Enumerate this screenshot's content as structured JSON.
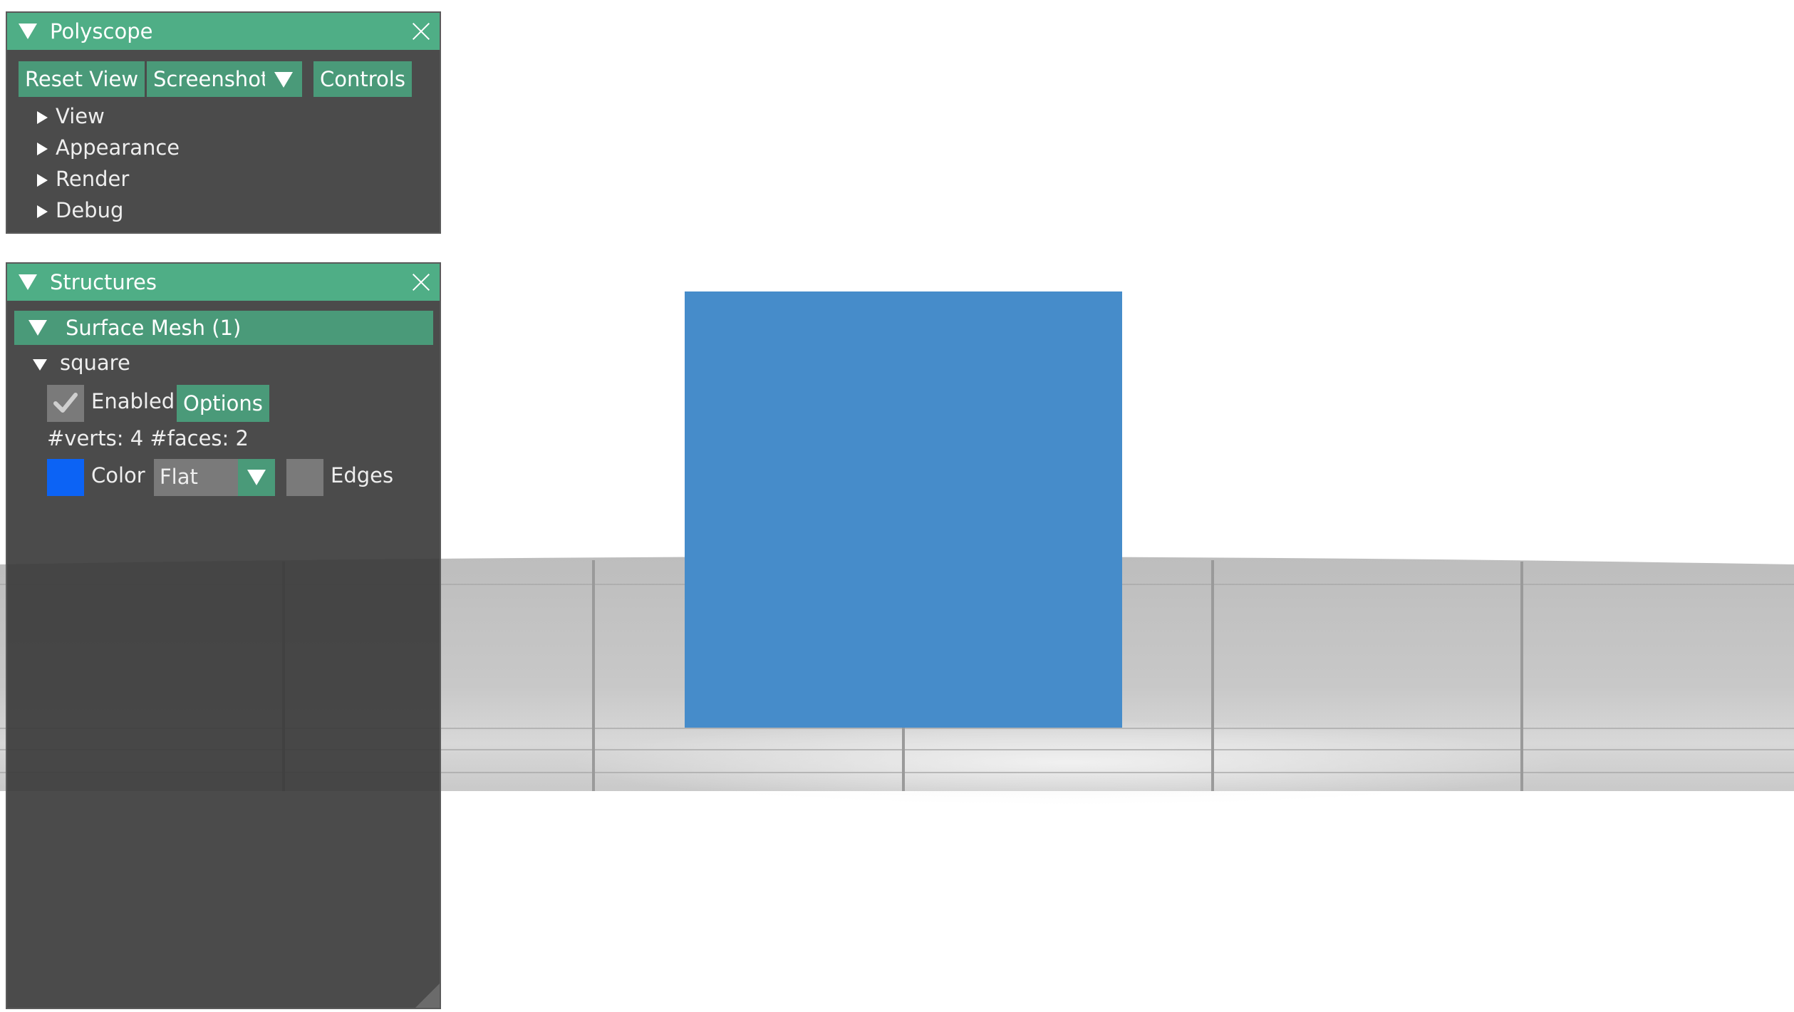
{
  "polyscope_window": {
    "title": "Polyscope",
    "buttons": {
      "reset_view": "Reset View",
      "screenshot": "Screenshot",
      "controls": "Controls"
    },
    "tree_items": [
      "View",
      "Appearance",
      "Render",
      "Debug"
    ]
  },
  "structures_window": {
    "title": "Structures",
    "group_header": "Surface Mesh (1)",
    "structure": {
      "name": "square",
      "enabled_label": "Enabled",
      "enabled": true,
      "options_label": "Options",
      "stats": "#verts: 4  #faces: 2",
      "color_label": "Color",
      "color": "#0c63f5",
      "shade_mode": "Flat",
      "edges_label": "Edges",
      "edges_enabled": false
    }
  },
  "colors": {
    "title_bar": "#4fae86",
    "button": "#4a9a79",
    "window_bg": "#373737",
    "mesh_render": "#468cca",
    "ground": "#c4c4c4"
  },
  "icons": [
    "collapse-triangle-icon",
    "close-icon",
    "expand-arrow-icon",
    "dropdown-arrow-icon",
    "checkmark-icon",
    "resize-grip-icon"
  ]
}
